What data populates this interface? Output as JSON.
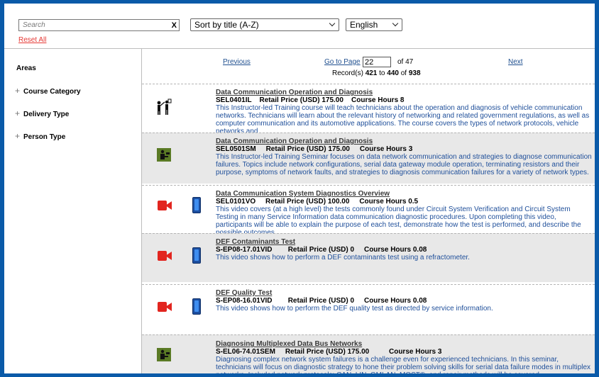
{
  "search": {
    "placeholder": "Search",
    "clear_label": "X"
  },
  "reset_label": "Reset All",
  "sort": {
    "selected": "Sort by title (A-Z)"
  },
  "language": {
    "selected": "English"
  },
  "sidebar": {
    "title": "Areas",
    "items": [
      {
        "label": "Course Category"
      },
      {
        "label": "Delivery Type"
      },
      {
        "label": "Person Type"
      }
    ]
  },
  "pager": {
    "previous": "Previous",
    "goto_label": "Go to Page",
    "page_value": "22",
    "of_label": "of 47",
    "next": "Next",
    "records_prefix": "Record(s)",
    "records_from": "421",
    "records_to_label": "to",
    "records_to": "440",
    "records_of_label": "of",
    "records_total": "938"
  },
  "records": [
    {
      "title": "Data Communication Operation and Diagnosis",
      "meta": "SEL0401IL    Retail Price (USD) 175.00    Course Hours 8",
      "desc": "This Instructor-led Training course will teach technicians about the operation and diagnosis of vehicle communication networks. Technicians will learn about the relevant history of networking and related government regulations, as well as computer communication and its automotive applications. The course covers the types of network protocols, vehicle networks and",
      "icons": [
        "instructor-led-icon"
      ]
    },
    {
      "title": "Data Communication Operation and Diagnosis",
      "meta": "SEL0501SM     Retail Price (USD) 175.00     Course Hours 3",
      "desc": "This Instructor-led Training Seminar focuses on data network communication and strategies to diagnose communication failures. Topics include network configurations, serial data gateway module operation, terminating resistors and their purpose, symptoms of network faults, and strategies to diagnosis communication failures for a variety of network types.",
      "icons": [
        "seminar-icon"
      ]
    },
    {
      "title": "Data Communication System Diagnostics Overview",
      "meta": "SEL0101VO     Retail Price (USD) 100.00     Course Hours 0.5",
      "desc": "This video covers (at a high level) the tests commonly found under Circuit System Verification and Circuit System Testing in many Service Information data communication diagnostic procedures. Upon completing this video, participants will be able to explain the purpose of each test, demonstrate how the test is performed, and describe the possible outcomes.",
      "icons": [
        "video-camera-icon",
        "tablet-icon"
      ]
    },
    {
      "title": "DEF Contaminants Test",
      "meta": "S-EP08-17.01VID        Retail Price (USD) 0     Course Hours 0.08",
      "desc": "This video shows how to perform a DEF contaminants test using a refractometer.",
      "icons": [
        "video-camera-icon",
        "tablet-icon"
      ]
    },
    {
      "title": "DEF Quality Test",
      "meta": "S-EP08-16.01VID        Retail Price (USD) 0     Course Hours 0.08",
      "desc": "This video shows how to perform the DEF quality test as directed by service information.",
      "icons": [
        "video-camera-icon",
        "tablet-icon"
      ]
    },
    {
      "title": "Diagnosing Multiplexed Data Bus Networks",
      "meta": "S-EL06-74.01SEM     Retail Price (USD) 175.00          Course Hours 3",
      "desc": "Diagnosing complex network system failures is a challenge even for experienced technicians. In this seminar, technicians will focus on diagnostic strategy to hone their problem solving skills for serial data failure modes in multiplex networks. Included network protocols: CAN, LIN, GMLAN, MOST®, and repair methods will be covered.",
      "icons": [
        "seminar-icon"
      ]
    }
  ]
}
